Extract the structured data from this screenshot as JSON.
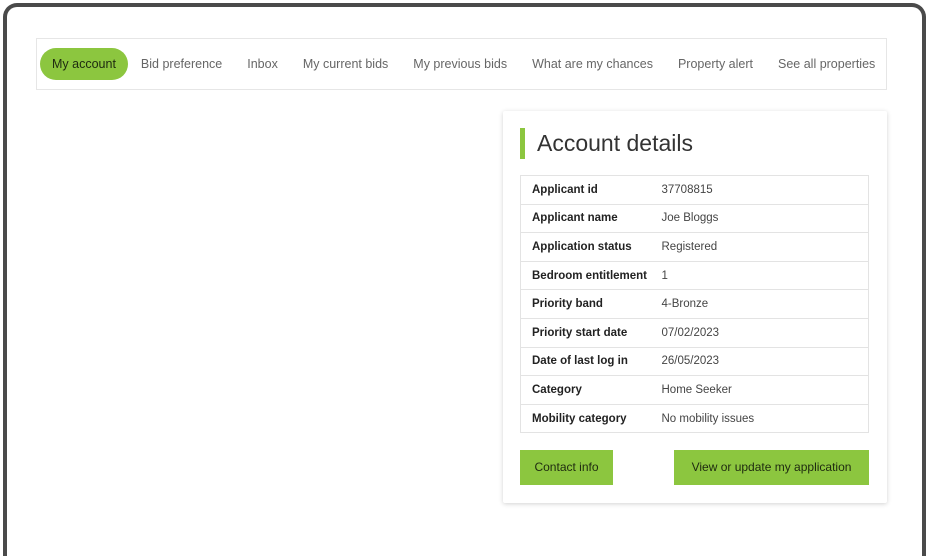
{
  "nav": {
    "items": [
      {
        "label": "My account",
        "active": true
      },
      {
        "label": "Bid preference",
        "active": false
      },
      {
        "label": "Inbox",
        "active": false
      },
      {
        "label": "My current bids",
        "active": false
      },
      {
        "label": "My previous bids",
        "active": false
      },
      {
        "label": "What are my chances",
        "active": false
      },
      {
        "label": "Property alert",
        "active": false
      },
      {
        "label": "See all properties",
        "active": false
      }
    ]
  },
  "account": {
    "title": "Account details",
    "rows": [
      {
        "key": "Applicant id",
        "value": "37708815"
      },
      {
        "key": "Applicant name",
        "value": "Joe Bloggs"
      },
      {
        "key": "Application status",
        "value": "Registered"
      },
      {
        "key": "Bedroom entitlement",
        "value": "1"
      },
      {
        "key": "Priority band",
        "value": "4-Bronze"
      },
      {
        "key": "Priority start date",
        "value": "07/02/2023"
      },
      {
        "key": "Date of last log in",
        "value": "26/05/2023"
      },
      {
        "key": "Category",
        "value": "Home Seeker"
      },
      {
        "key": "Mobility category",
        "value": "No mobility issues"
      }
    ],
    "contact_button": "Contact info",
    "update_button": "View or update my application"
  },
  "colors": {
    "accent": "#8cc63f",
    "frame": "#4a4a4a"
  }
}
